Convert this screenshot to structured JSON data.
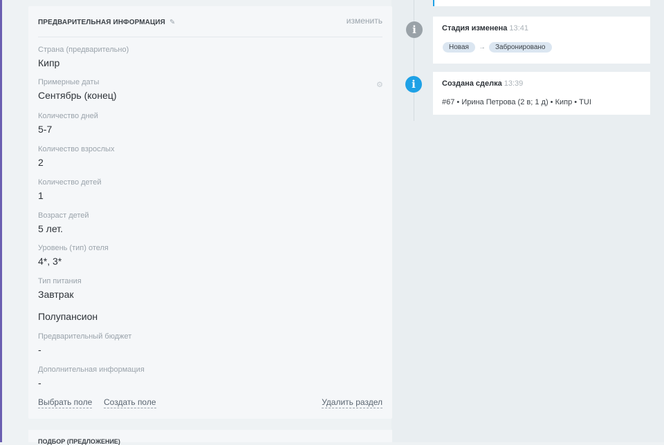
{
  "card": {
    "title": "ПРЕДВАРИТЕЛЬНАЯ ИНФОРМАЦИЯ",
    "edit_label": "изменить",
    "fields": [
      {
        "label": "Страна (предварительно)",
        "value": "Кипр"
      },
      {
        "label": "Примерные даты",
        "value": "Сентябрь (конец)"
      },
      {
        "label": "Количество дней",
        "value": "5-7"
      },
      {
        "label": "Количество взрослых",
        "value": "2"
      },
      {
        "label": "Количество детей",
        "value": "1"
      },
      {
        "label": "Возраст детей",
        "value": "5 лет."
      },
      {
        "label": "Уровень (тип) отеля",
        "value": "4*, 3*"
      },
      {
        "label": "Тип питания",
        "value": "Завтрак",
        "value2": "Полупансион"
      },
      {
        "label": "Предварительный бюджет",
        "value": "-"
      },
      {
        "label": "Дополнительная информация",
        "value": "-"
      }
    ],
    "footer": {
      "choose_field": "Выбрать поле",
      "create_field": "Создать поле",
      "delete_section": "Удалить раздел"
    }
  },
  "card2": {
    "title": "ПОДБОР (ПРЕДЛОЖЕНИЕ)"
  },
  "timeline": {
    "events": [
      {
        "title": "Стадия изменена",
        "time": "13:41",
        "from_stage": "Новая",
        "to_stage": "Забронировано"
      },
      {
        "title": "Создана сделка",
        "time": "13:39",
        "description": "#67 • Ирина Петрова (2 в; 1 д) • Кипр • TUI"
      }
    ]
  },
  "colors": {
    "accent": "#1ea1e6",
    "info_gray": "#9aa2a8",
    "pill_bg": "#dbe6f1"
  },
  "icons": [
    "pencil-icon",
    "gear-icon",
    "info-icon",
    "arrow-right-icon"
  ]
}
